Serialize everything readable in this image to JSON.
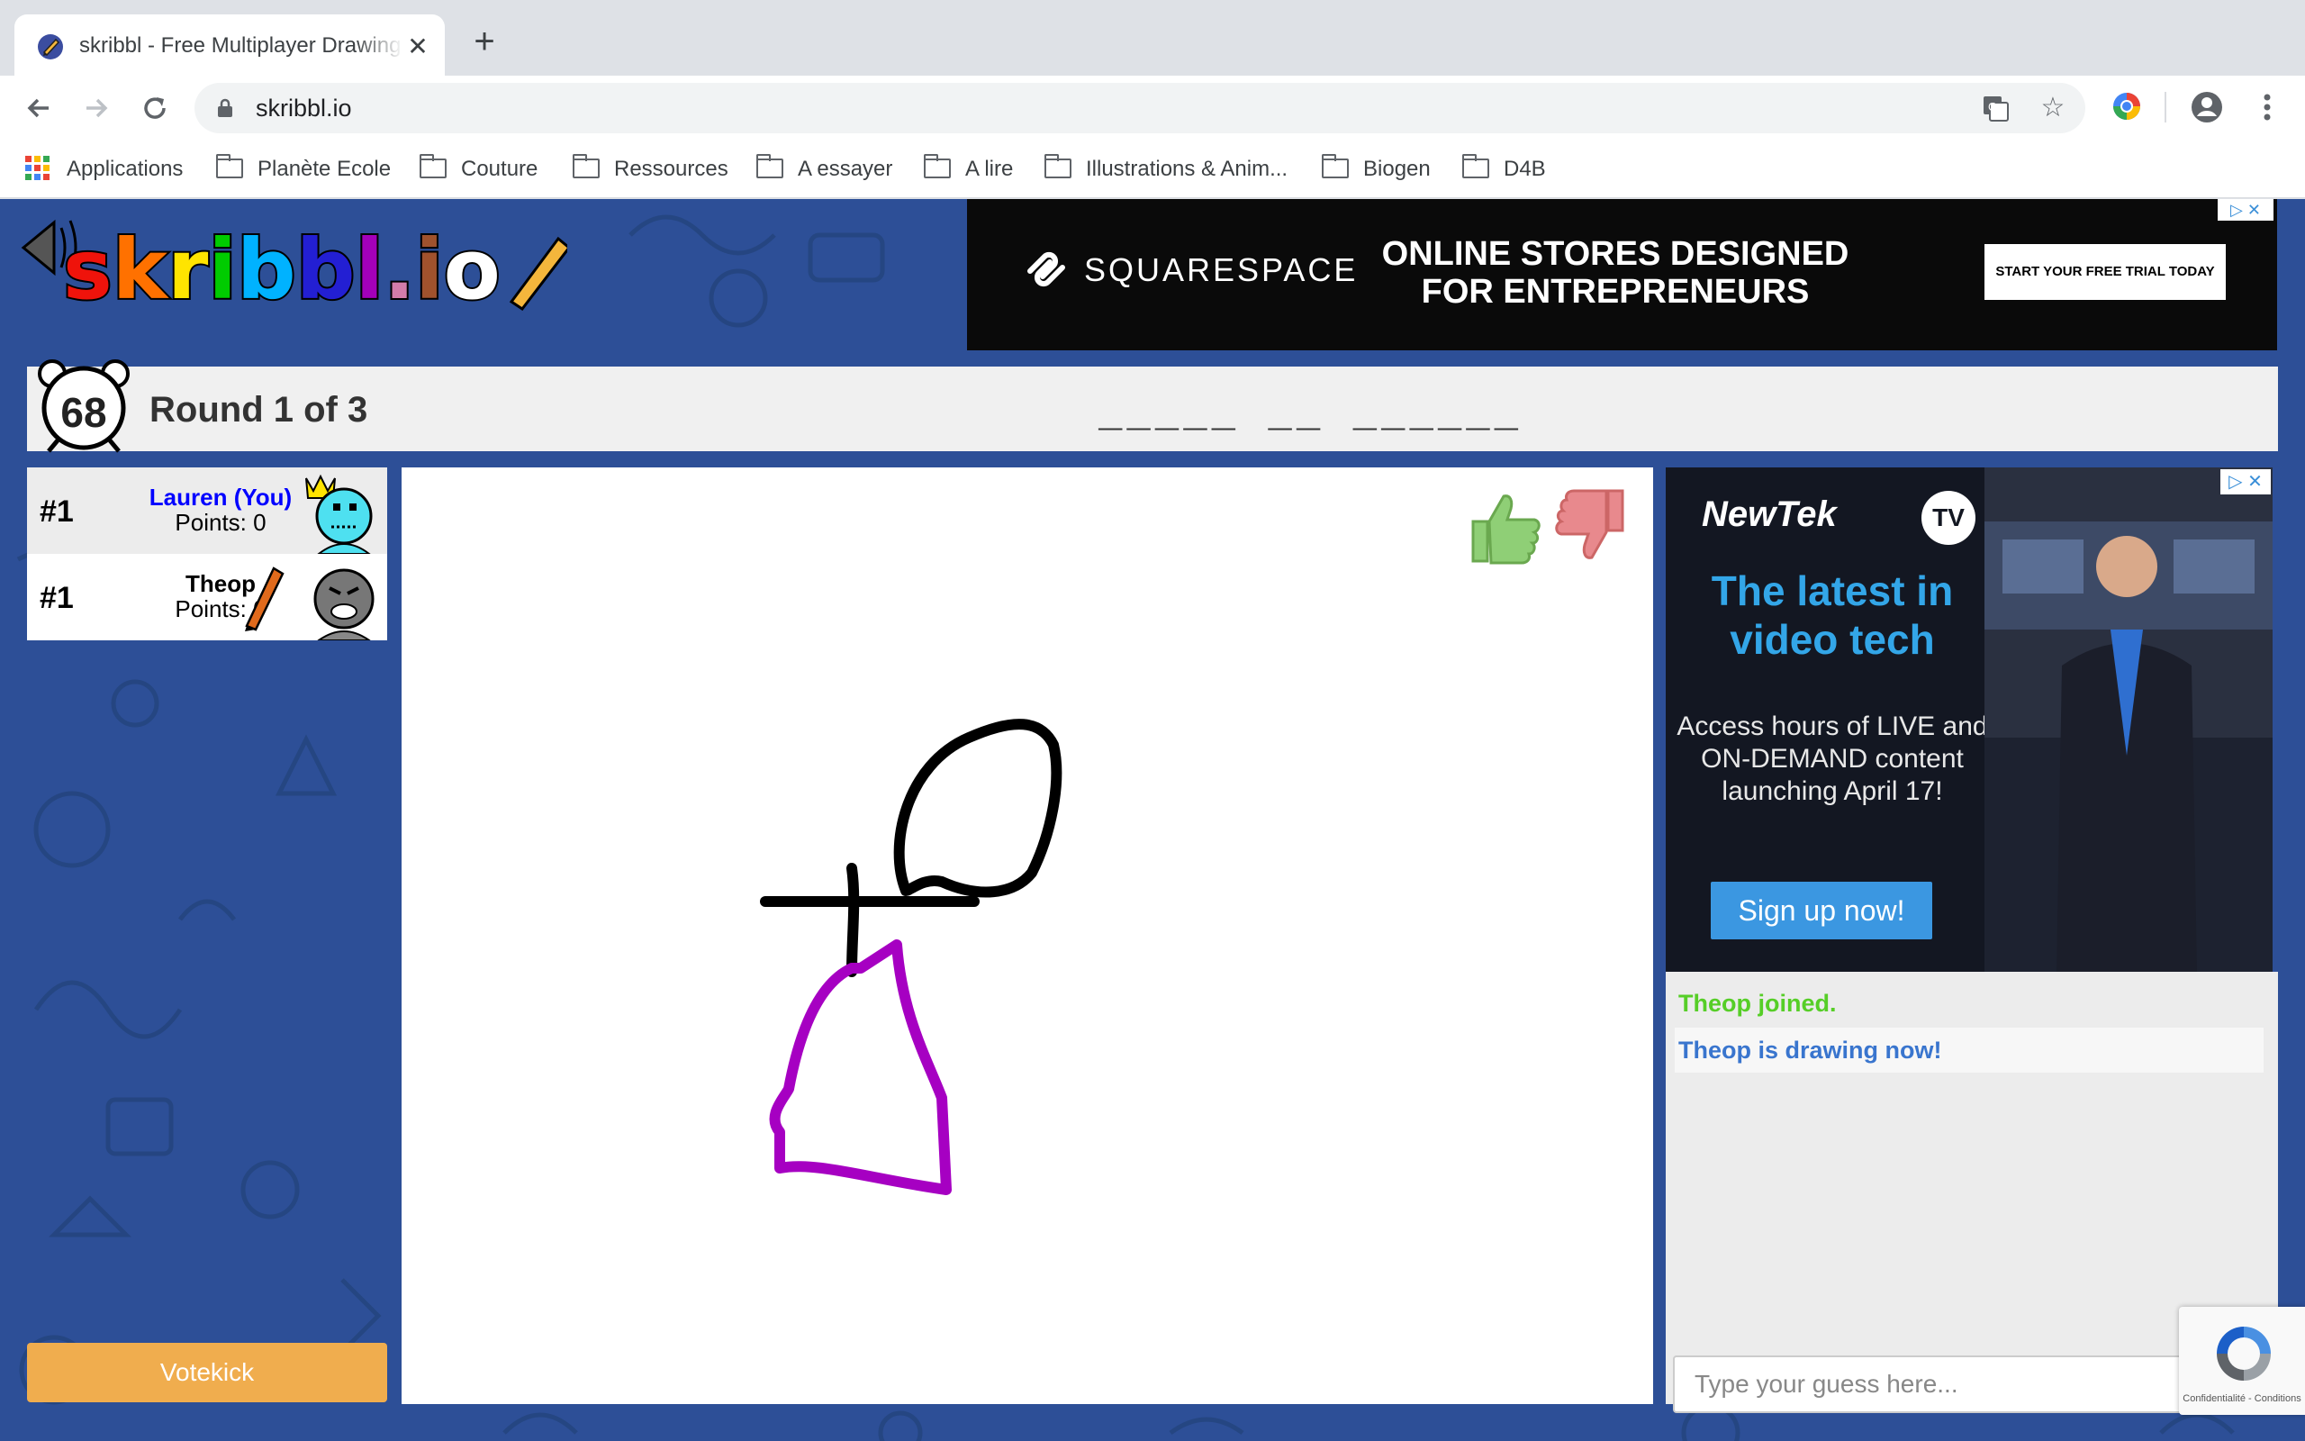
{
  "browser": {
    "tab_title": "skribbl - Free Multiplayer Drawing & Guessing Game",
    "url": "skribbl.io",
    "bookmarks": [
      {
        "label": "Applications",
        "icon": "apps-grid-icon"
      },
      {
        "label": "Planète Ecole",
        "icon": "folder-icon"
      },
      {
        "label": "Couture",
        "icon": "folder-icon"
      },
      {
        "label": "Ressources",
        "icon": "folder-icon"
      },
      {
        "label": "A essayer",
        "icon": "folder-icon"
      },
      {
        "label": "A lire",
        "icon": "folder-icon"
      },
      {
        "label": "Illustrations & Anim...",
        "icon": "folder-icon"
      },
      {
        "label": "Biogen",
        "icon": "folder-icon"
      },
      {
        "label": "D4B",
        "icon": "folder-icon"
      }
    ]
  },
  "top_ad": {
    "brand": "SQUARESPACE",
    "headline": "ONLINE STORES DESIGNED FOR ENTREPRENEURS",
    "cta": "START YOUR FREE TRIAL TODAY"
  },
  "game": {
    "timer": "68",
    "round_text": "Round 1 of 3",
    "word_hint": "_____ __ ______"
  },
  "players": [
    {
      "rank": "#1",
      "name": "Lauren (You)",
      "points": "Points: 0",
      "name_color": "#0000ff"
    },
    {
      "rank": "#1",
      "name": "Theop",
      "points": "Points: 0",
      "name_color": "#000000"
    }
  ],
  "side_ad": {
    "brand": "NewTek",
    "badge": "TV",
    "headline": "The latest in video tech",
    "body": "Access hours of LIVE and ON-DEMAND content launching April 17!",
    "cta": "Sign up now!"
  },
  "chat": {
    "messages": [
      {
        "text": "Theop joined.",
        "color": "#56ce27"
      },
      {
        "text": "Theop is drawing now!",
        "color": "#3975ce"
      }
    ],
    "input_placeholder": "Type your guess here..."
  },
  "votekick_label": "Votekick",
  "recaptcha_text": "Confidentialité - Conditions",
  "colors": {
    "page_bg": "#2d4f97",
    "votekick": "#f0ad4e",
    "stroke_black": "#000000",
    "stroke_purple": "#a600c2"
  }
}
